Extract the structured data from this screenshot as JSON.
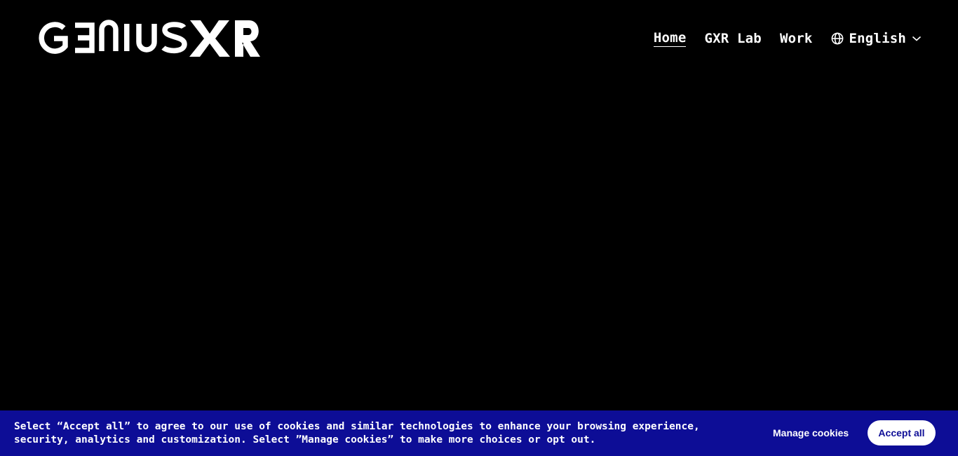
{
  "logo": {
    "text": "GENIUSXR",
    "icon": "geniusxr-logo"
  },
  "nav": {
    "items": [
      {
        "label": "Home",
        "active": true
      },
      {
        "label": "GXR Lab",
        "active": false
      },
      {
        "label": "Work",
        "active": false
      }
    ],
    "language": {
      "label": "English",
      "icon": "globe-icon",
      "dropdown_icon": "chevron-down-icon"
    }
  },
  "cookie_banner": {
    "text": "Select “Accept all” to agree to our use of cookies and similar technologies to enhance your browsing experience, security, analytics and customization. Select ”Manage cookies” to make more choices or opt out.",
    "manage_label": "Manage cookies",
    "accept_label": "Accept all",
    "background_color": "#0d0d96",
    "accent_color": "#ffffff"
  }
}
